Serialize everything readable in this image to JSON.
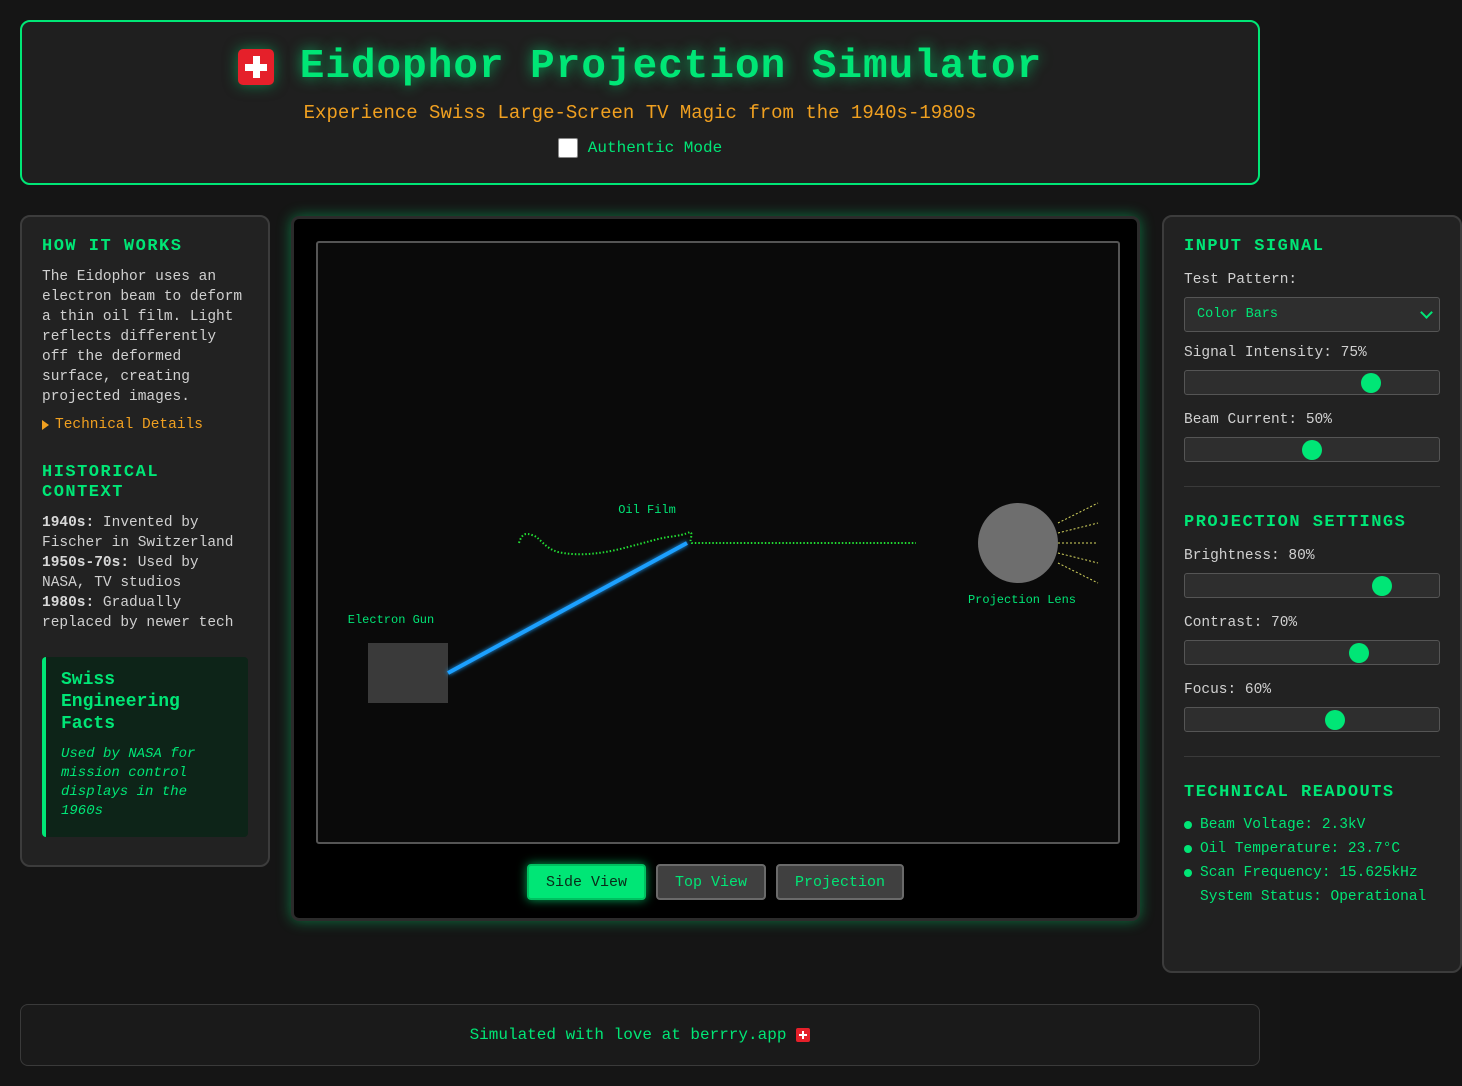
{
  "header": {
    "title": "Eidophor Projection Simulator",
    "subtitle": "Experience Swiss Large-Screen TV Magic from the 1940s-1980s",
    "authentic_mode_label": "Authentic Mode",
    "authentic_mode_checked": false,
    "flag_icon": "swiss-flag-icon"
  },
  "left": {
    "how_title": "HOW IT WORKS",
    "how_text": "The Eidophor uses an electron beam to deform a thin oil film. Light reflects differently off the deformed surface, creating projected images.",
    "details_label": "Technical Details",
    "history_title": "HISTORICAL CONTEXT",
    "history": [
      {
        "era": "1940s:",
        "text": " Invented by Fischer in Switzerland"
      },
      {
        "era": "1950s-70s:",
        "text": " Used by NASA, TV studios"
      },
      {
        "era": "1980s:",
        "text": " Gradually replaced by newer tech"
      }
    ],
    "facts_title": "Swiss Engineering Facts",
    "facts_text": "Used by NASA for mission control displays in the 1960s"
  },
  "display": {
    "labels": {
      "oil_film": "Oil Film",
      "electron_gun": "Electron Gun",
      "projection_lens": "Projection Lens"
    },
    "buttons": [
      {
        "label": "Side View",
        "active": true
      },
      {
        "label": "Top View",
        "active": false
      },
      {
        "label": "Projection",
        "active": false
      }
    ],
    "colors": {
      "beam": "#1ea0ff",
      "oil": "#22dd33",
      "accent": "#00e676",
      "rays": "#d8d860"
    }
  },
  "right": {
    "input_title": "INPUT SIGNAL",
    "test_pattern_label": "Test Pattern:",
    "test_pattern_value": "Color Bars",
    "signal_label": "Signal Intensity: 75%",
    "signal_value": 75,
    "beam_label": "Beam Current: 50%",
    "beam_value": 50,
    "projection_title": "PROJECTION SETTINGS",
    "brightness_label": "Brightness: 80%",
    "brightness_value": 80,
    "contrast_label": "Contrast: 70%",
    "contrast_value": 70,
    "focus_label": "Focus: 60%",
    "focus_value": 60,
    "readouts_title": "TECHNICAL READOUTS",
    "readouts": [
      {
        "text": "Beam Voltage: 2.3kV",
        "dot": true
      },
      {
        "text": "Oil Temperature: 23.7°C",
        "dot": true
      },
      {
        "text": "Scan Frequency: 15.625kHz",
        "dot": true
      },
      {
        "text": "System Status: Operational",
        "dot": false
      }
    ]
  },
  "footer": {
    "text": "Simulated with love at berrry.app"
  }
}
